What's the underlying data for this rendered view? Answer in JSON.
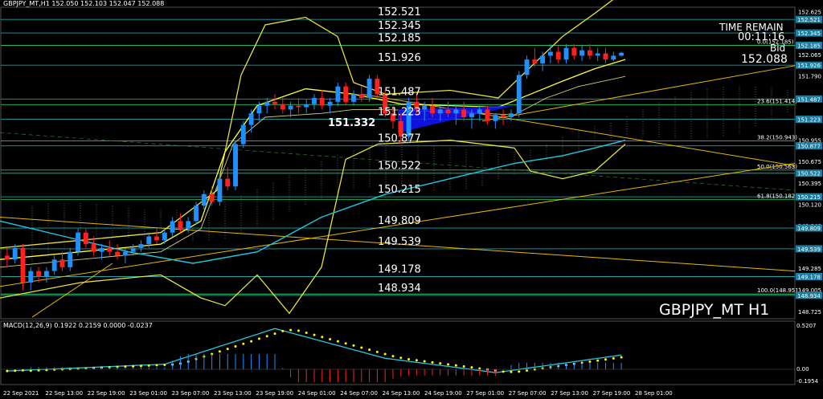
{
  "header": {
    "info": "GBPJPY_MT,H1  152.050 152.103 152.047 152.088"
  },
  "overlay": {
    "time_remain_label": "TIME REMAIN",
    "time_remain_value": "00:11:16",
    "bid_label": "Bid",
    "bid_value": "152.088",
    "symbol_caption": "GBPJPY_MT H1",
    "marker_price": "151.332"
  },
  "colors": {
    "background": "#000000",
    "bull_candle": "#1e90ff",
    "bear_candle": "#ff2020",
    "bollinger": "#ffff33",
    "envelope": "#e6e040",
    "trendline": "#e6b800",
    "level_line": "#1aa3a3",
    "fib_line": "#22c55e",
    "cyan_ma": "#1ec8e6",
    "macd_line": "#26c6da",
    "macd_signal": "#ffff00",
    "triangle_fill": "#1414ff"
  },
  "macd": {
    "label": "MACD(12,26,9) 0.1922 0.2159 0.0000 -0.0237",
    "scale_top": "0.5207",
    "scale_zero": "0.00",
    "scale_bottom": "-0.1954"
  },
  "chart_data": {
    "type": "candlestick",
    "symbol": "GBPJPY_MT",
    "timeframe": "H1",
    "ylim": [
      148.63,
      152.68
    ],
    "price_ticks": [
      "152.625",
      "152.345",
      "152.065",
      "151.790",
      "151.510",
      "151.230",
      "150.955",
      "150.675",
      "150.395",
      "150.120",
      "149.840",
      "149.560",
      "149.285",
      "149.005",
      "148.725"
    ],
    "level_lines": [
      "152.521",
      "152.345",
      "152.185",
      "151.926",
      "151.487",
      "151.223",
      "150.877",
      "150.522",
      "150.215",
      "149.809",
      "149.539",
      "149.178",
      "148.934"
    ],
    "fib_levels": [
      {
        "label": "0.0(152.185)",
        "value": 152.185
      },
      {
        "label": "23.6(151.414)",
        "value": 151.414
      },
      {
        "label": "38.2(150.943)",
        "value": 150.943
      },
      {
        "label": "50.0(150.563)",
        "value": 150.563
      },
      {
        "label": "61.8(150.182)",
        "value": 150.182
      },
      {
        "label": "100.0(148.951)",
        "value": 148.951
      }
    ],
    "time_labels": [
      "22 Sep 2021",
      "22 Sep 13:00",
      "22 Sep 19:00",
      "23 Sep 01:00",
      "23 Sep 07:00",
      "23 Sep 13:00",
      "23 Sep 19:00",
      "24 Sep 01:00",
      "24 Sep 07:00",
      "24 Sep 13:00",
      "24 Sep 19:00",
      "27 Sep 01:00",
      "27 Sep 07:00",
      "27 Sep 13:00",
      "27 Sep 19:00",
      "28 Sep 01:00"
    ],
    "candles": [
      [
        149.45,
        149.55,
        149.3,
        149.4
      ],
      [
        149.4,
        149.6,
        149.35,
        149.55
      ],
      [
        149.55,
        149.6,
        149.0,
        149.1
      ],
      [
        149.1,
        149.3,
        149.0,
        149.25
      ],
      [
        149.25,
        149.3,
        149.1,
        149.18
      ],
      [
        149.18,
        149.3,
        149.1,
        149.25
      ],
      [
        149.25,
        149.45,
        149.2,
        149.4
      ],
      [
        149.4,
        149.5,
        149.25,
        149.3
      ],
      [
        149.3,
        149.55,
        149.25,
        149.5
      ],
      [
        149.5,
        149.8,
        149.45,
        149.75
      ],
      [
        149.75,
        149.8,
        149.55,
        149.6
      ],
      [
        149.6,
        149.7,
        149.45,
        149.5
      ],
      [
        149.5,
        149.6,
        149.4,
        149.55
      ],
      [
        149.55,
        149.65,
        149.45,
        149.5
      ],
      [
        149.5,
        149.6,
        149.4,
        149.45
      ],
      [
        149.45,
        149.55,
        149.35,
        149.5
      ],
      [
        149.5,
        149.6,
        149.45,
        149.55
      ],
      [
        149.55,
        149.65,
        149.5,
        149.6
      ],
      [
        149.6,
        149.75,
        149.55,
        149.7
      ],
      [
        149.7,
        149.8,
        149.6,
        149.65
      ],
      [
        149.65,
        149.8,
        149.6,
        149.75
      ],
      [
        149.75,
        149.95,
        149.7,
        149.9
      ],
      [
        149.9,
        150.0,
        149.75,
        149.8
      ],
      [
        149.8,
        149.95,
        149.75,
        149.9
      ],
      [
        149.9,
        150.15,
        149.85,
        150.1
      ],
      [
        150.1,
        150.3,
        150.05,
        150.25
      ],
      [
        150.25,
        150.35,
        150.1,
        150.15
      ],
      [
        150.15,
        150.5,
        150.1,
        150.45
      ],
      [
        150.45,
        150.6,
        150.3,
        150.35
      ],
      [
        150.35,
        150.95,
        150.3,
        150.9
      ],
      [
        150.9,
        151.2,
        150.85,
        151.15
      ],
      [
        151.15,
        151.35,
        151.05,
        151.3
      ],
      [
        151.3,
        151.45,
        151.2,
        151.4
      ],
      [
        151.4,
        151.5,
        151.3,
        151.45
      ],
      [
        151.45,
        151.55,
        151.35,
        151.42
      ],
      [
        151.42,
        151.5,
        151.3,
        151.35
      ],
      [
        151.35,
        151.45,
        151.25,
        151.4
      ],
      [
        151.4,
        151.5,
        151.3,
        151.38
      ],
      [
        151.38,
        151.48,
        151.3,
        151.42
      ],
      [
        151.42,
        151.55,
        151.35,
        151.5
      ],
      [
        151.5,
        151.6,
        151.35,
        151.4
      ],
      [
        151.4,
        151.5,
        151.3,
        151.45
      ],
      [
        151.45,
        151.7,
        151.4,
        151.65
      ],
      [
        151.65,
        151.7,
        151.4,
        151.45
      ],
      [
        151.45,
        151.6,
        151.4,
        151.55
      ],
      [
        151.55,
        151.65,
        151.45,
        151.5
      ],
      [
        151.5,
        151.8,
        151.45,
        151.75
      ],
      [
        151.75,
        151.8,
        151.5,
        151.55
      ],
      [
        151.55,
        151.6,
        151.25,
        151.3
      ],
      [
        151.3,
        151.4,
        151.1,
        151.2
      ],
      [
        151.2,
        151.3,
        150.9,
        151.0
      ],
      [
        151.0,
        151.5,
        150.95,
        151.45
      ],
      [
        151.45,
        151.55,
        151.3,
        151.35
      ],
      [
        151.35,
        151.45,
        151.2,
        151.4
      ],
      [
        151.4,
        151.5,
        151.25,
        151.3
      ],
      [
        151.3,
        151.4,
        151.2,
        151.35
      ],
      [
        151.35,
        151.45,
        151.25,
        151.3
      ],
      [
        151.3,
        151.4,
        151.15,
        151.35
      ],
      [
        151.35,
        151.45,
        151.2,
        151.25
      ],
      [
        151.25,
        151.35,
        151.1,
        151.3
      ],
      [
        151.3,
        151.4,
        151.2,
        151.35
      ],
      [
        151.35,
        151.4,
        151.15,
        151.2
      ],
      [
        151.2,
        151.3,
        151.1,
        151.28
      ],
      [
        151.28,
        151.35,
        151.15,
        151.25
      ],
      [
        151.25,
        151.35,
        151.2,
        151.3
      ],
      [
        151.3,
        151.85,
        151.25,
        151.8
      ],
      [
        151.8,
        152.05,
        151.75,
        152.0
      ],
      [
        152.0,
        152.15,
        151.9,
        151.95
      ],
      [
        151.95,
        152.1,
        151.85,
        152.05
      ],
      [
        152.05,
        152.2,
        151.95,
        152.1
      ],
      [
        152.1,
        152.18,
        151.95,
        152.0
      ],
      [
        152.0,
        152.2,
        151.95,
        152.15
      ],
      [
        152.15,
        152.2,
        152.0,
        152.05
      ],
      [
        152.05,
        152.18,
        151.98,
        152.12
      ],
      [
        152.12,
        152.2,
        152.0,
        152.05
      ],
      [
        152.05,
        152.15,
        151.98,
        152.08
      ],
      [
        152.08,
        152.15,
        151.95,
        152.0
      ],
      [
        152.0,
        152.1,
        151.98,
        152.05
      ],
      [
        152.05,
        152.1,
        152.04,
        152.088
      ]
    ]
  }
}
